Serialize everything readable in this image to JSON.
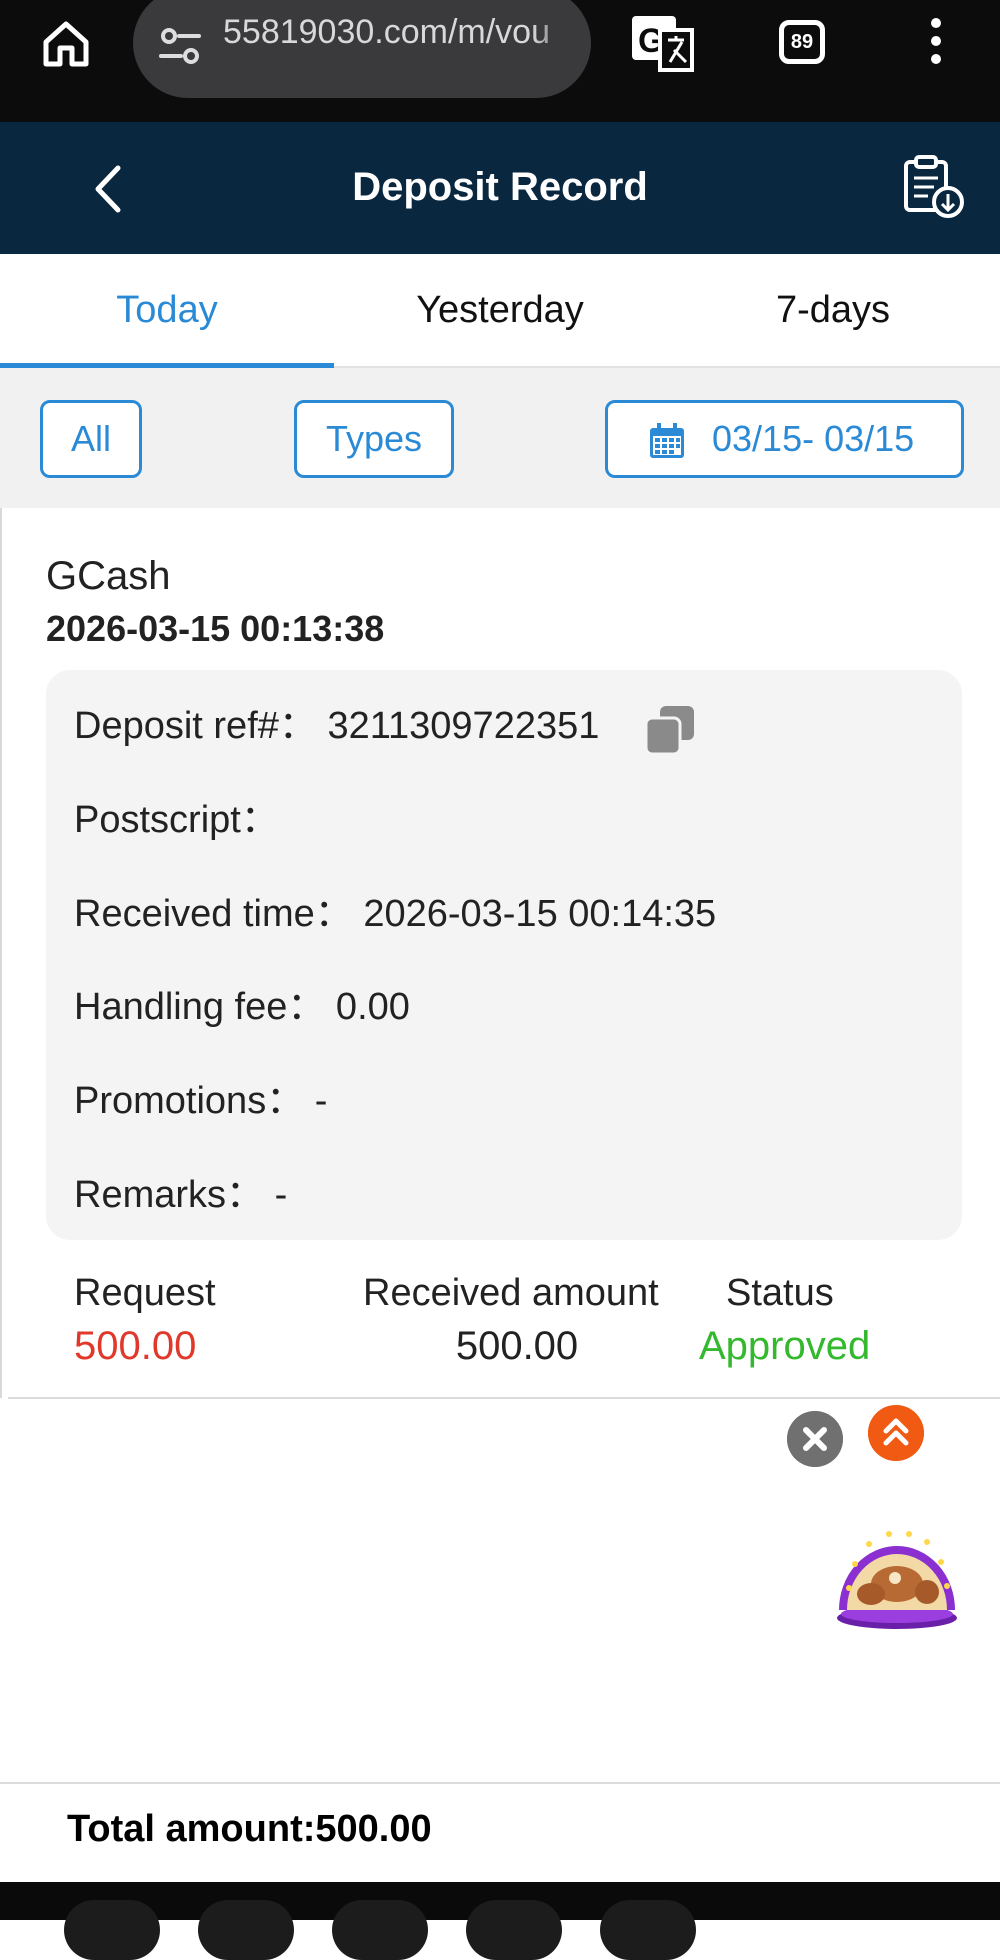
{
  "browser": {
    "url": "55819030.com/m/vou",
    "tab_count": "89"
  },
  "header": {
    "title": "Deposit Record"
  },
  "tabs": [
    {
      "label": "Today",
      "active": true
    },
    {
      "label": "Yesterday",
      "active": false
    },
    {
      "label": "7-days",
      "active": false
    }
  ],
  "filters": {
    "all_label": "All",
    "types_label": "Types",
    "date_range": "03/15- 03/15"
  },
  "record": {
    "method": "GCash",
    "created_time": "2026-03-15 00:13:38",
    "details": {
      "deposit_ref": "Deposit ref#： 3211309722351",
      "postscript": "Postscript：",
      "received_time": "Received time： 2026-03-15 00:14:35",
      "handling_fee": "Handling fee： 0.00",
      "promotions": "Promotions： -",
      "remarks": "Remarks： -"
    },
    "summary": {
      "request_label": "Request",
      "request_value": "500.00",
      "received_label": "Received amount",
      "received_value": "500.00",
      "status_label": "Status",
      "status_value": "Approved"
    }
  },
  "total": {
    "text": "Total amount:500.00"
  },
  "colors": {
    "header_bg": "#0a2740",
    "accent": "#2a8ad6",
    "request_red": "#e0382b",
    "approved_green": "#33b82e",
    "scroll_top_orange": "#f05a12"
  }
}
